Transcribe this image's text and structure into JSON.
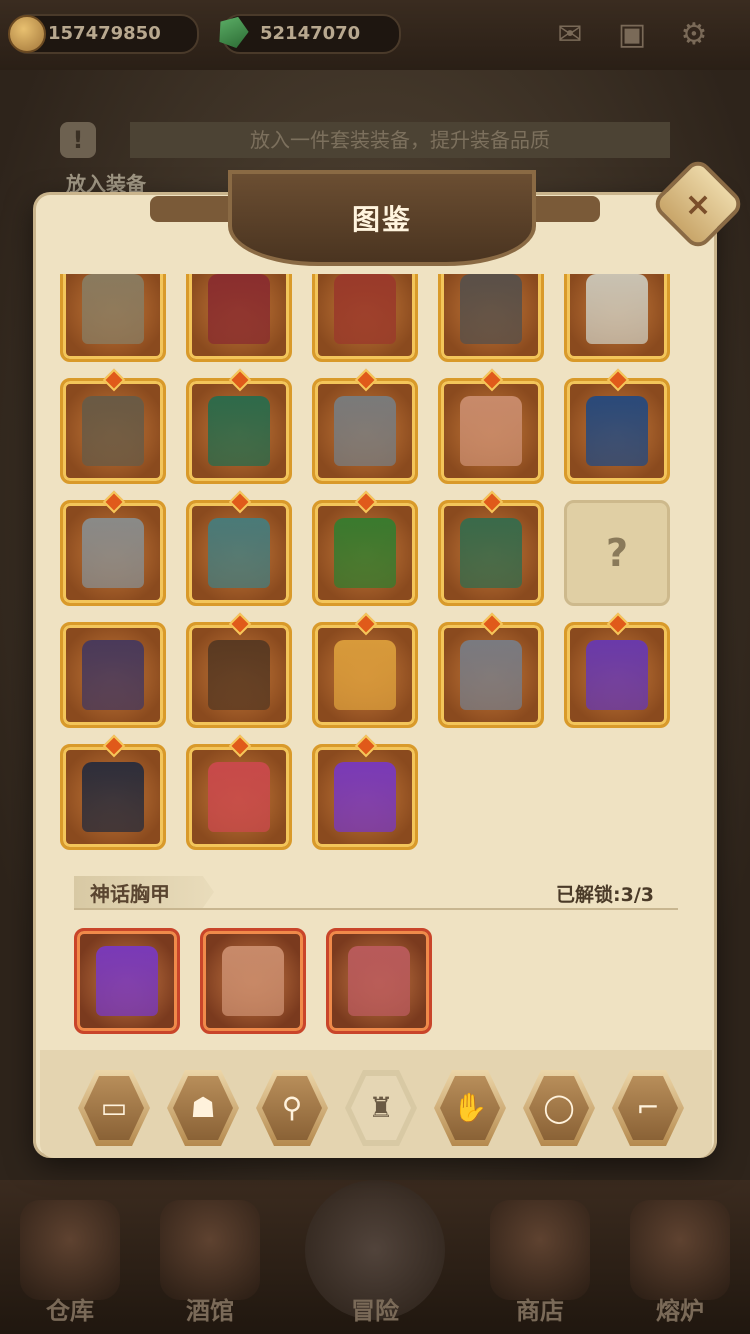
{
  "currency": {
    "coins": "157479850",
    "gems": "52147070"
  },
  "top_icons": {
    "mail": "✉",
    "box": "▣",
    "settings": "⚙"
  },
  "hint": {
    "icon": "!",
    "text": "放入一件套装装备，提升装备品质"
  },
  "behind_label": "放入装备",
  "modal": {
    "title": "图鉴",
    "close": "×"
  },
  "grid_items": [
    {
      "color": "#8a7a5e",
      "gem": false
    },
    {
      "color": "#8a2e2e",
      "gem": false
    },
    {
      "color": "#9a3a2a",
      "gem": false
    },
    {
      "color": "#5a5048",
      "gem": false
    },
    {
      "color": "#c9c2b2",
      "gem": false
    },
    {
      "color": "#6a5a44",
      "gem": true
    },
    {
      "color": "#2e6a4a",
      "gem": true
    },
    {
      "color": "#7a7a7a",
      "gem": true
    },
    {
      "color": "#c88a6a",
      "gem": true
    },
    {
      "color": "#2a4a7a",
      "gem": true
    },
    {
      "color": "#8a8a88",
      "gem": true
    },
    {
      "color": "#4a7a78",
      "gem": true
    },
    {
      "color": "#3a7a2e",
      "gem": true
    },
    {
      "color": "#3a6a4a",
      "gem": true
    },
    {
      "color": "",
      "gem": false,
      "empty": true,
      "label": "?"
    },
    {
      "color": "#4a3a5a",
      "gem": false
    },
    {
      "color": "#5a3a22",
      "gem": true
    },
    {
      "color": "#d89a3a",
      "gem": true
    },
    {
      "color": "#7a7a80",
      "gem": true
    },
    {
      "color": "#6a3aaa",
      "gem": true
    },
    {
      "color": "#2e2e3a",
      "gem": true
    },
    {
      "color": "#c84a4a",
      "gem": true
    },
    {
      "color": "#7a3ab8",
      "gem": true
    }
  ],
  "section": {
    "name": "神话胸甲",
    "count": "已解锁:3/3"
  },
  "myth_items": [
    {
      "color": "#7a3ab8"
    },
    {
      "color": "#c88a6a"
    },
    {
      "color": "#b85a5a"
    }
  ],
  "tabs": [
    {
      "icon": "▭",
      "name": "tab-book"
    },
    {
      "icon": "☗",
      "name": "tab-helmet"
    },
    {
      "icon": "⚲",
      "name": "tab-amulet"
    },
    {
      "icon": "♜",
      "name": "tab-armor",
      "active": true
    },
    {
      "icon": "✋",
      "name": "tab-gloves"
    },
    {
      "icon": "◯",
      "name": "tab-ring"
    },
    {
      "icon": "⌐",
      "name": "tab-boots"
    }
  ],
  "bottom_nav": [
    {
      "label": "仓库"
    },
    {
      "label": "酒馆"
    },
    {
      "label": "冒险"
    },
    {
      "label": "商店"
    },
    {
      "label": "熔炉"
    }
  ]
}
